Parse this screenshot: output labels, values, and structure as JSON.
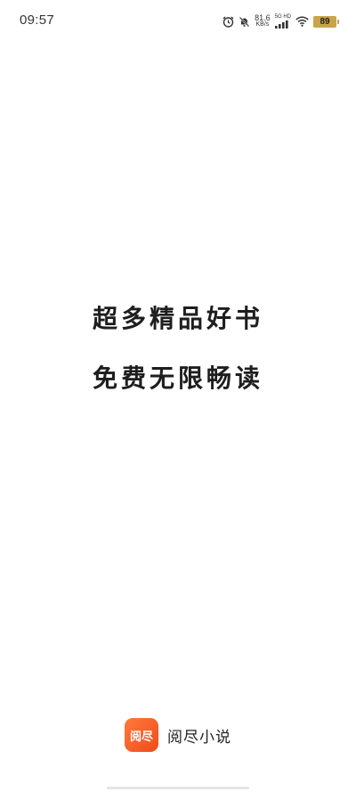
{
  "status_bar": {
    "time": "09:57",
    "net_speed_value": "81.6",
    "net_speed_unit": "KB/s",
    "network_label": "5G HD",
    "battery": "89",
    "battery_color": "#c8a44b",
    "icons": [
      "alarm-icon",
      "mute-bell-icon",
      "signal-icon",
      "wifi-icon",
      "battery-icon"
    ]
  },
  "slogan": {
    "line1": "超多精品好书",
    "line2": "免费无限畅读"
  },
  "brand": {
    "logo_text": "阅尽",
    "name": "阅尽小说",
    "accent_color": "#f35a24"
  }
}
